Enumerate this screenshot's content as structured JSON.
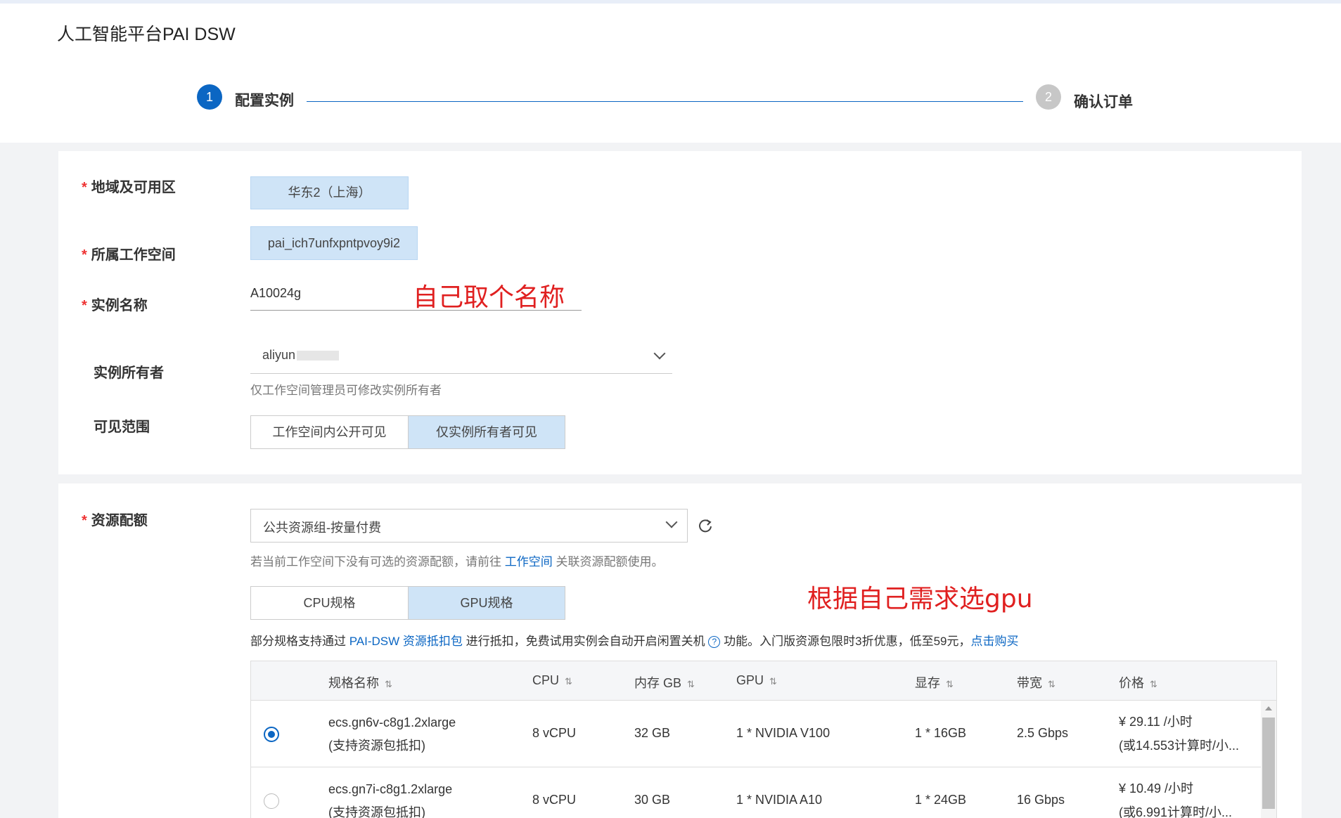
{
  "header": {
    "title": "人工智能平台PAI DSW",
    "steps": [
      {
        "num": "1",
        "label": "配置实例"
      },
      {
        "num": "2",
        "label": "确认订单"
      }
    ]
  },
  "form": {
    "region": {
      "label": "地域及可用区",
      "value": "华东2（上海）"
    },
    "workspace": {
      "label": "所属工作空间",
      "value": "pai_ich7unfxpntpvoy9i2"
    },
    "instance_name": {
      "label": "实例名称",
      "value": "A10024g",
      "annotation": "自己取个名称"
    },
    "owner": {
      "label": "实例所有者",
      "value": "aliyun",
      "hint": "仅工作空间管理员可修改实例所有者"
    },
    "visibility": {
      "label": "可见范围",
      "options": [
        "工作空间内公开可见",
        "仅实例所有者可见"
      ],
      "selected": "仅实例所有者可见"
    }
  },
  "resource": {
    "label": "资源配额",
    "select_value": "公共资源组-按量付费",
    "hint_prefix": "若当前工作空间下没有可选的资源配额，请前往",
    "hint_link": "工作空间",
    "hint_suffix": "关联资源配额使用。",
    "spec_tabs": [
      "CPU规格",
      "GPU规格"
    ],
    "selected_tab": "GPU规格",
    "annotation": "根据自己需求选gpu",
    "info": {
      "prefix": "部分规格支持通过",
      "link1": "PAI-DSW 资源抵扣包",
      "middle": "进行抵扣，免费试用实例会自动开启闲置关机",
      "suffix": "功能。入门版资源包限时3折优惠，低至59元，",
      "link2": "点击购买"
    }
  },
  "table": {
    "columns": [
      "规格名称",
      "CPU",
      "内存 GB",
      "GPU",
      "显存",
      "带宽",
      "价格"
    ],
    "sort_icon": "⇅",
    "rows": [
      {
        "name": "ecs.gn6v-c8g1.2xlarge",
        "note": "(支持资源包抵扣)",
        "cpu": "8 vCPU",
        "mem": "32 GB",
        "gpu": "1 * NVIDIA V100",
        "vram": "1 * 16GB",
        "bw": "2.5 Gbps",
        "price": "¥ 29.11 /小时",
        "price2": "(或14.553计算时/小...",
        "selected": true
      },
      {
        "name": "ecs.gn7i-c8g1.2xlarge",
        "note": "(支持资源包抵扣)",
        "cpu": "8 vCPU",
        "mem": "30 GB",
        "gpu": "1 * NVIDIA A10",
        "vram": "1 * 24GB",
        "bw": "16 Gbps",
        "price": "¥ 10.49 /小时",
        "price2": "(或6.991计算时/小...",
        "selected": false
      }
    ]
  }
}
